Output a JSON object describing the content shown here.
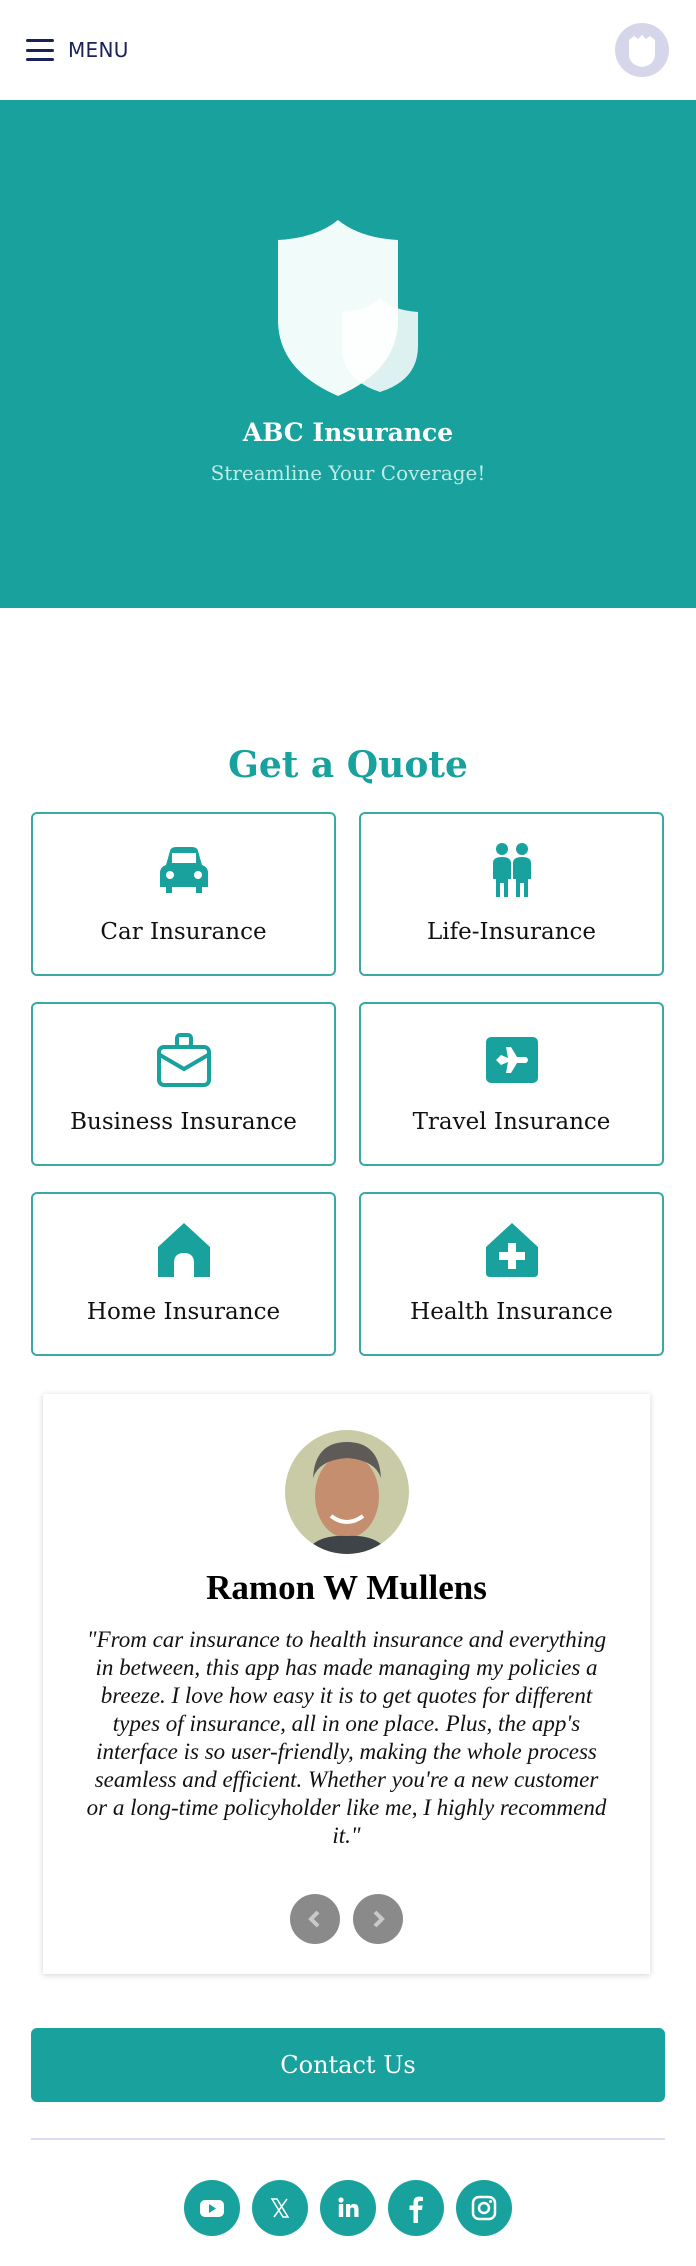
{
  "header": {
    "menu_label": "MENU"
  },
  "hero": {
    "title": "ABC Insurance",
    "subtitle": "Streamline Your Coverage!"
  },
  "quote_section": {
    "title": "Get a Quote",
    "options": [
      {
        "label": "Car Insurance",
        "icon": "car-icon"
      },
      {
        "label": "Life-Insurance",
        "icon": "people-icon"
      },
      {
        "label": "Business Insurance",
        "icon": "briefcase-icon"
      },
      {
        "label": "Travel Insurance",
        "icon": "airplane-icon"
      },
      {
        "label": "Home Insurance",
        "icon": "home-icon"
      },
      {
        "label": "Health Insurance",
        "icon": "medical-home-icon"
      }
    ]
  },
  "testimonial": {
    "name": "Ramon W Mullens",
    "quote": "\"From car insurance to health insurance and everything in between, this app has made managing my policies a breeze. I love how easy it is to get quotes for different types of insurance, all in one place. Plus, the app's interface is so user-friendly, making the whole process seamless and efficient. Whether you're a new customer or a long-time policyholder like me, I highly recommend it.\""
  },
  "contact": {
    "label": "Contact Us"
  },
  "social": [
    "youtube",
    "x",
    "linkedin",
    "facebook",
    "instagram"
  ],
  "colors": {
    "accent": "#18a19d",
    "nav_text": "#1b2256",
    "arrow_gray": "#8a8a8a"
  }
}
